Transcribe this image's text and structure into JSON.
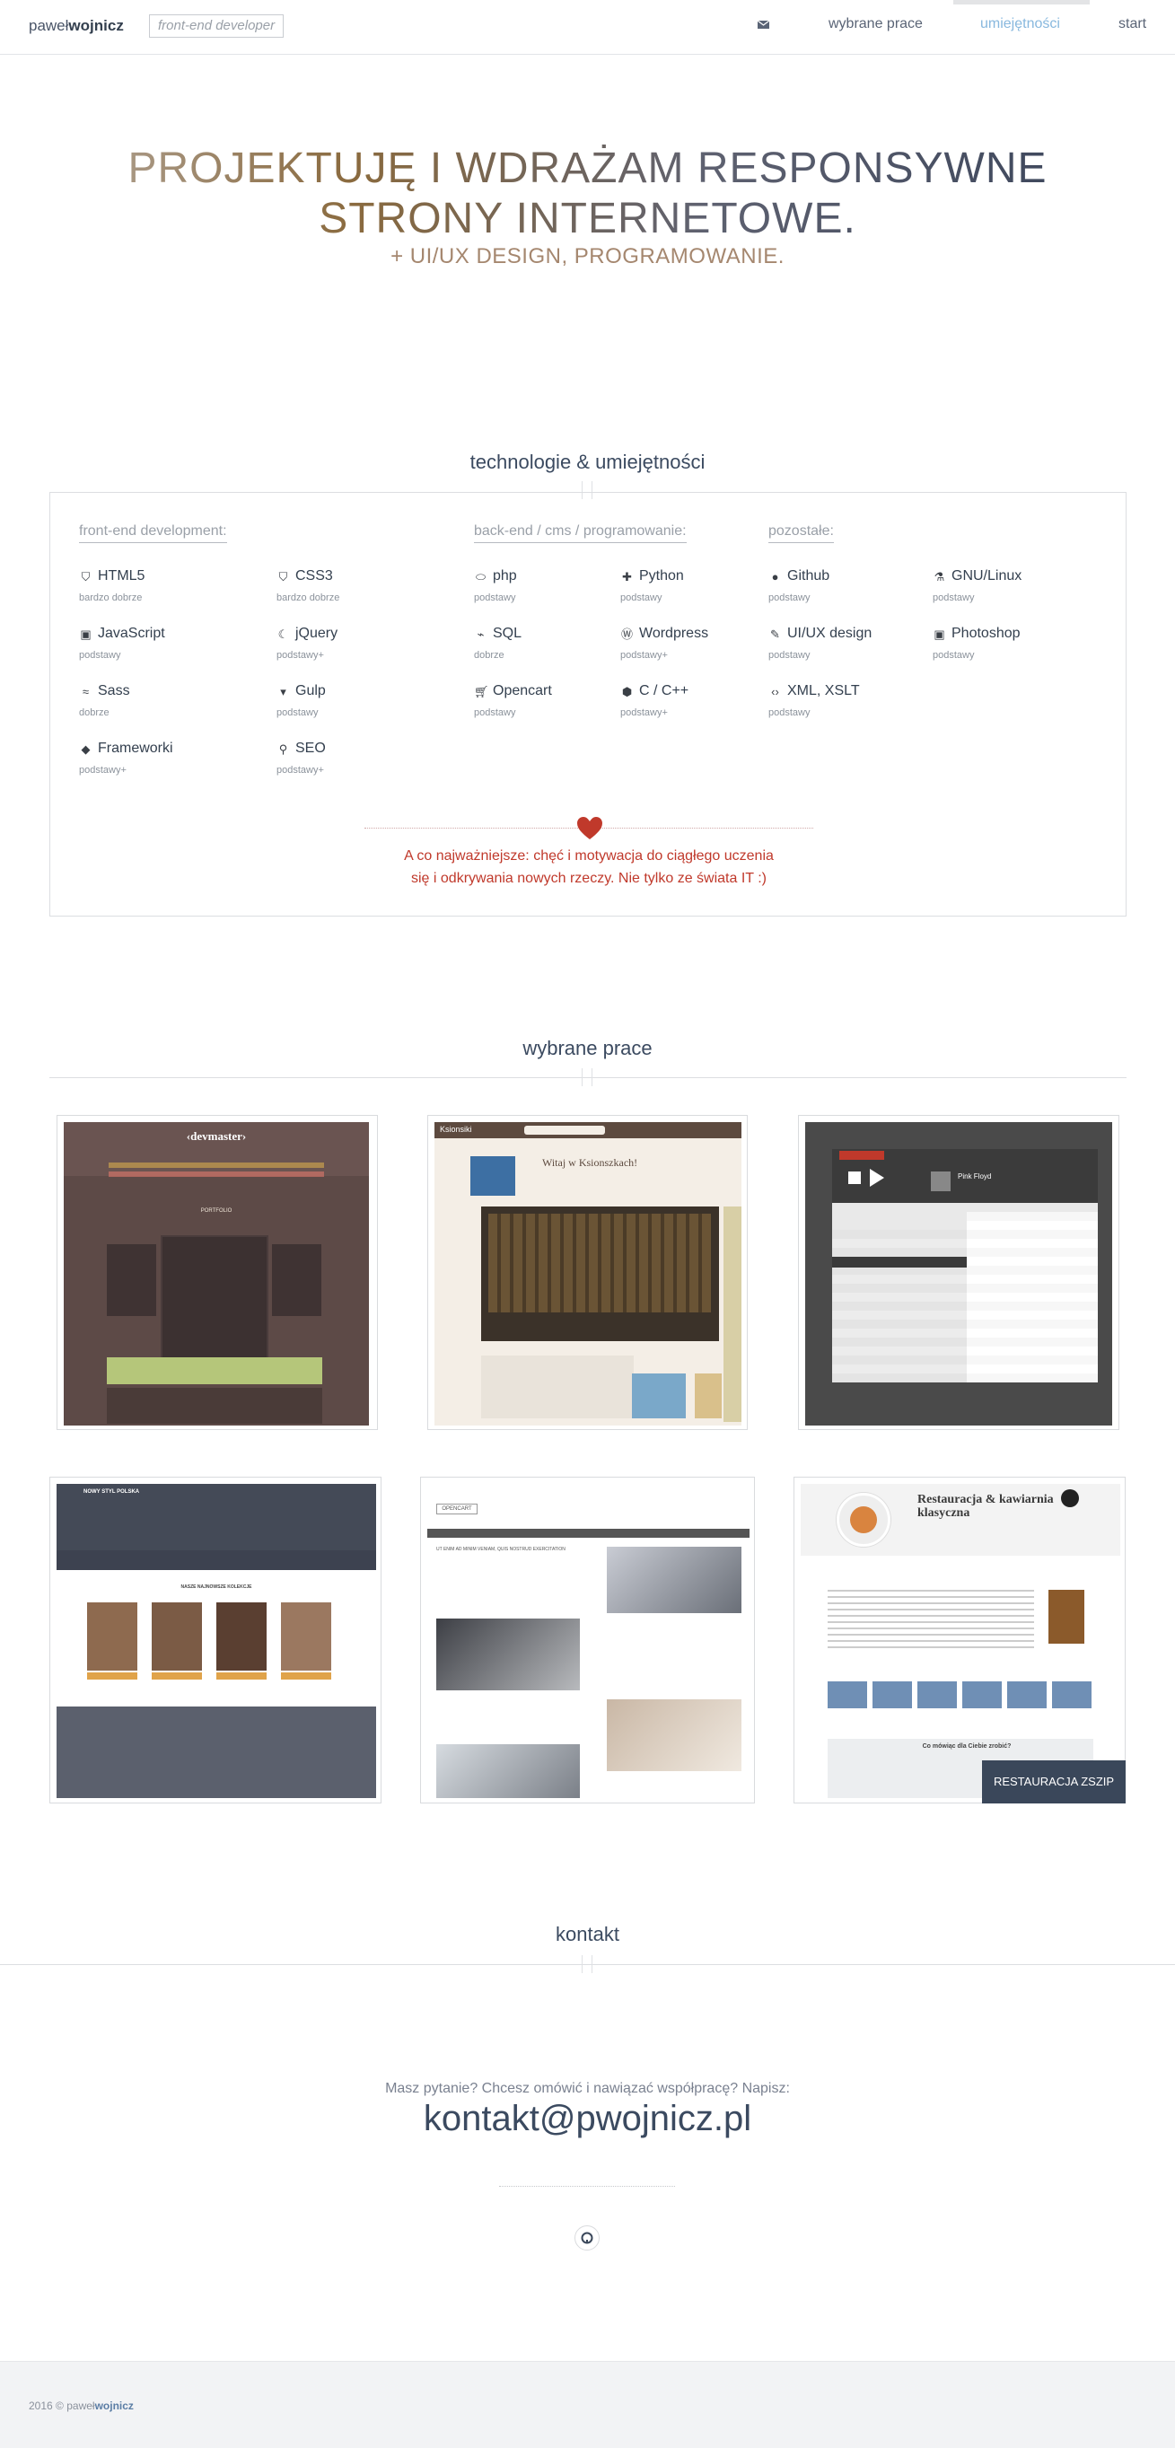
{
  "nav": {
    "logo_light": "paweł",
    "logo_bold": "wojnicz",
    "tagline": "front-end developer",
    "mail_icon": "envelope-icon",
    "links": [
      "wybrane prace",
      "umiejętności",
      "start"
    ],
    "active": "umiejętności"
  },
  "hero": {
    "line1": "PROJEKTUJĘ I WDRAŻAM RESPONSYWNE",
    "line2": "STRONY INTERNETOWE.",
    "sub": "+ UI/UX DESIGN, PROGRAMOWANIE."
  },
  "skills": {
    "title": "technologie & umiejętności",
    "columns": [
      "front-end development:",
      "back-end / cms / programowanie:",
      "pozostałe:"
    ],
    "frontend": [
      {
        "icon": "html5-icon",
        "name": "HTML5",
        "level": "bardzo dobrze"
      },
      {
        "icon": "css3-icon",
        "name": "CSS3",
        "level": "bardzo dobrze"
      },
      {
        "icon": "javascript-icon",
        "name": "JavaScript",
        "level": "podstawy"
      },
      {
        "icon": "jquery-icon",
        "name": "jQuery",
        "level": "podstawy+"
      },
      {
        "icon": "sass-icon",
        "name": "Sass",
        "level": "dobrze"
      },
      {
        "icon": "gulp-icon",
        "name": "Gulp",
        "level": "podstawy"
      },
      {
        "icon": "frameworks-icon",
        "name": "Frameworki",
        "level": "podstawy+"
      },
      {
        "icon": "search-icon",
        "name": "SEO",
        "level": "podstawy+"
      }
    ],
    "backend": [
      {
        "icon": "php-icon",
        "name": "php",
        "level": "podstawy"
      },
      {
        "icon": "python-icon",
        "name": "Python",
        "level": "podstawy"
      },
      {
        "icon": "sql-icon",
        "name": "SQL",
        "level": "dobrze"
      },
      {
        "icon": "wordpress-icon",
        "name": "Wordpress",
        "level": "podstawy+"
      },
      {
        "icon": "cart-icon",
        "name": "Opencart",
        "level": "podstawy"
      },
      {
        "icon": "cpp-icon",
        "name": "C / C++",
        "level": "podstawy+"
      }
    ],
    "other": [
      {
        "icon": "github-icon",
        "name": "Github",
        "level": "podstawy"
      },
      {
        "icon": "linux-icon",
        "name": "GNU/Linux",
        "level": "podstawy"
      },
      {
        "icon": "pen-icon",
        "name": "UI/UX design",
        "level": "podstawy"
      },
      {
        "icon": "photoshop-icon",
        "name": "Photoshop",
        "level": "podstawy"
      },
      {
        "icon": "code-icon",
        "name": "XML, XSLT",
        "level": "podstawy"
      }
    ],
    "motto_line1": "A co najważniejsze: chęć i motywacja do ciągłego uczenia",
    "motto_line2": "się i odkrywania nowych rzeczy. Nie tylko ze świata IT :)"
  },
  "works": {
    "title": "wybrane prace",
    "thumbs": [
      {
        "brand": "‹devmaster›",
        "caption": "PORTFOLIO"
      },
      {
        "brand": "Ksionsiki",
        "caption": "Witaj w Ksionszkach!"
      },
      {
        "brand": "",
        "caption": "Pink Floyd"
      },
      {
        "brand": "NOWY STYL POLSKA",
        "caption": "NASZE NAJNOWSZE KOLEKCJE"
      },
      {
        "brand": "OPENCART",
        "caption": "UT ENIM AD MINIM VENIAM, QUIS NOSTRUD EXERCITATION"
      },
      {
        "brand": "Restauracja & kawiarnia klasyczna",
        "caption": "Co mówiąc dla Ciebie zrobić?"
      }
    ],
    "badge": "RESTAURACJA ZSZIP"
  },
  "contact": {
    "title": "kontakt",
    "question": "Masz pytanie? Chcesz omówić i nawiązać współpracę? Napisz:",
    "email": "kontakt@pwojnicz.pl",
    "social_icon": "github-icon"
  },
  "footer": {
    "year": "2016 © ",
    "name_light": "paweł",
    "name_bold": "wojnicz"
  },
  "colors": {
    "accent": "#88b8de",
    "heading": "#3b4a60",
    "motto": "#c0392b",
    "badge_bg": "#3a475a"
  }
}
